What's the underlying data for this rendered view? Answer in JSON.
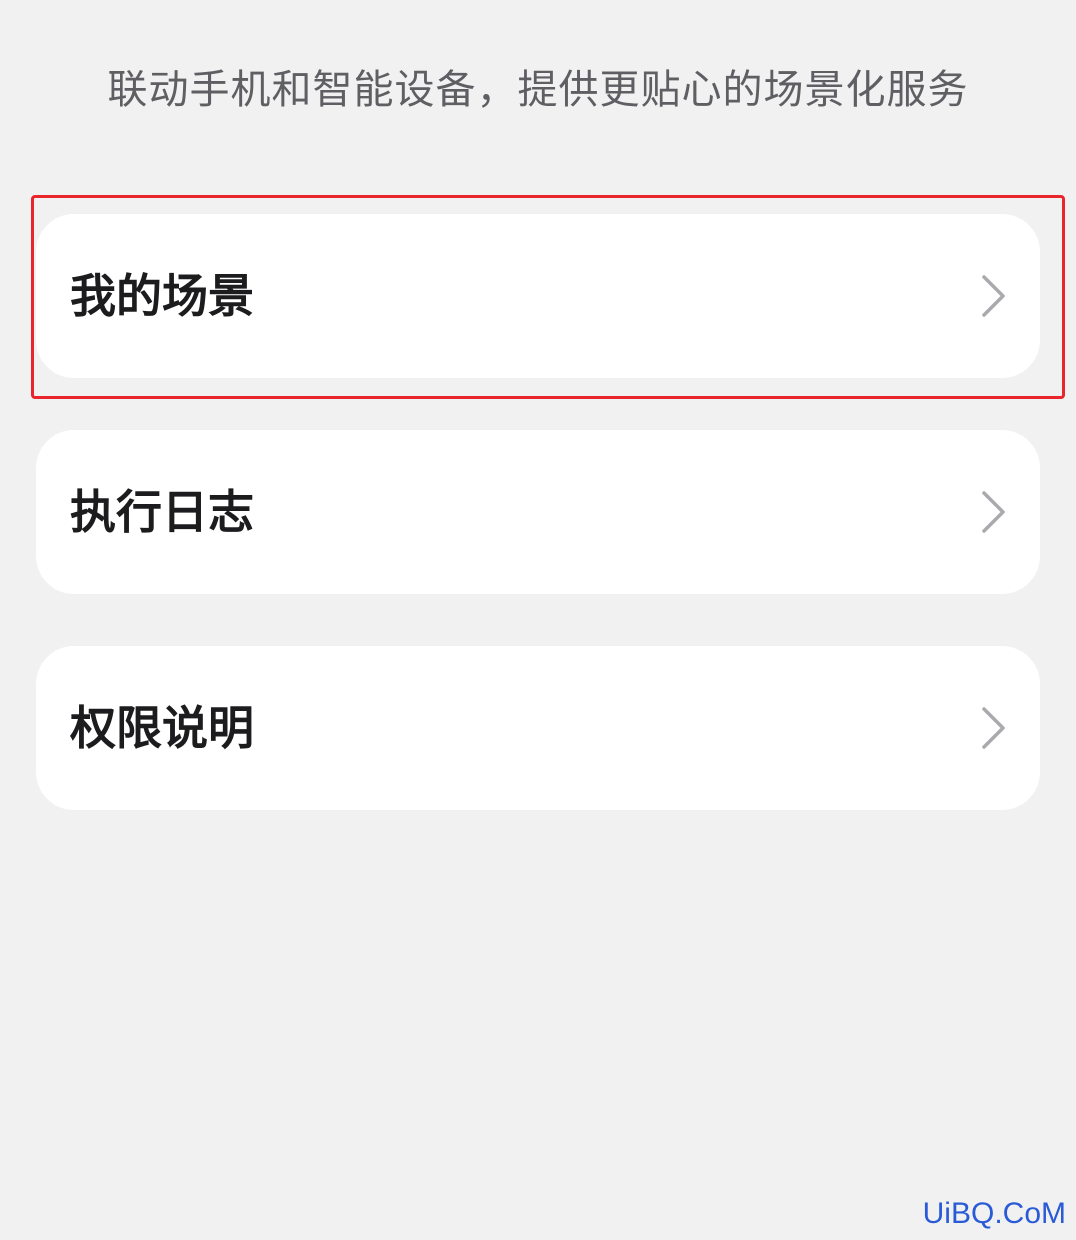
{
  "header": {
    "subtitle": "联动手机和智能设备，提供更贴心的场景化服务"
  },
  "menu": {
    "items": [
      {
        "label": "我的场景",
        "icon": "chevron-right-icon",
        "highlighted": true
      },
      {
        "label": "执行日志",
        "icon": "chevron-right-icon",
        "highlighted": false
      },
      {
        "label": "权限说明",
        "icon": "chevron-right-icon",
        "highlighted": false
      }
    ]
  },
  "annotation": {
    "highlight_color": "#e8262b"
  },
  "watermark": {
    "text": "UiBQ.CoM",
    "color": "#2a5bd6"
  },
  "colors": {
    "background": "#f1f1f2",
    "card": "#ffffff",
    "chevron": "#a9a9ae"
  }
}
